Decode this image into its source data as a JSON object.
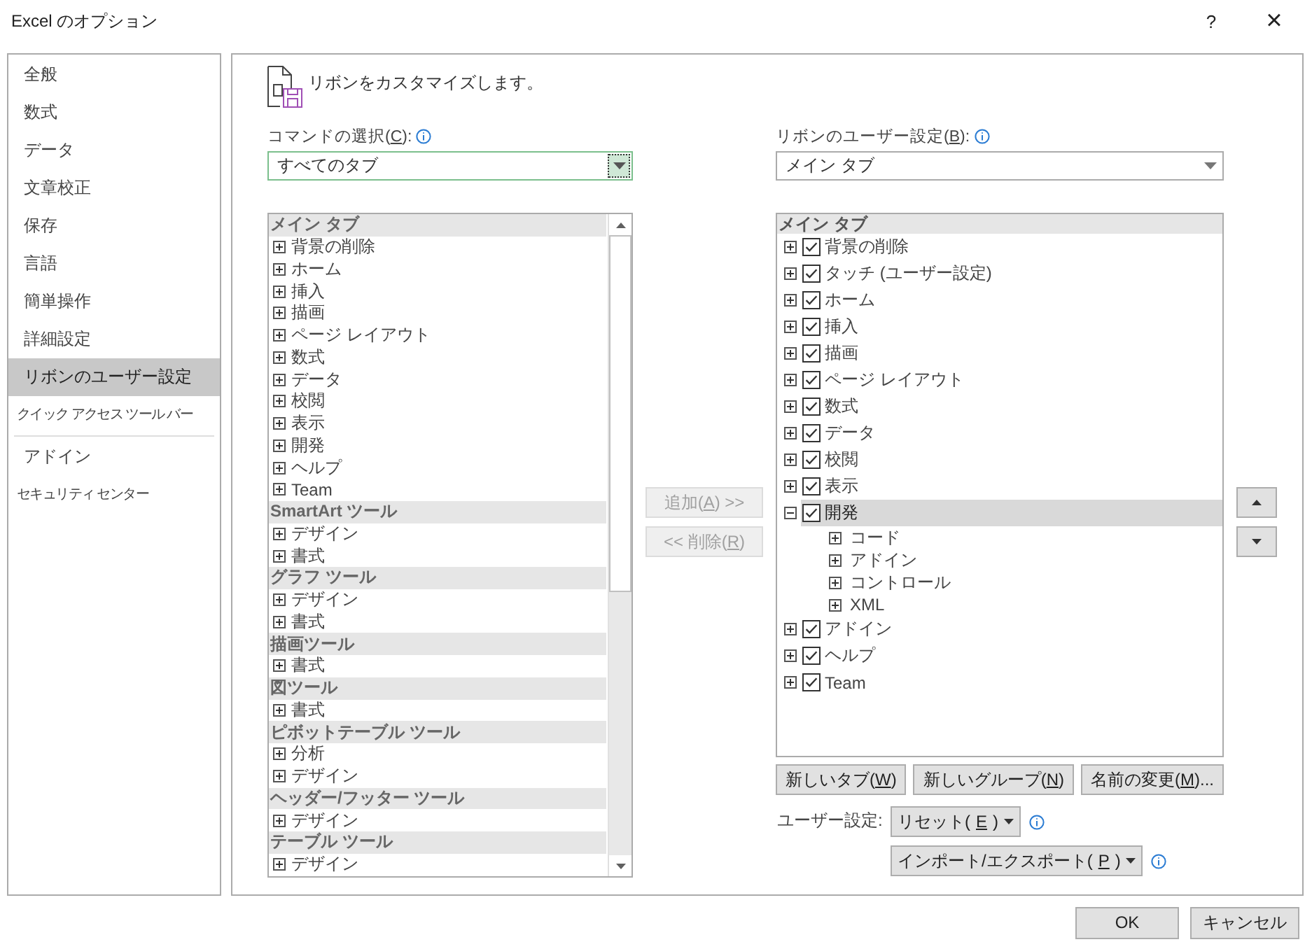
{
  "window": {
    "title": "Excel のオプション",
    "help": "?",
    "close": "×"
  },
  "sidebar": {
    "sections": [
      [
        {
          "label": "全般",
          "selected": false
        },
        {
          "label": "数式",
          "selected": false
        },
        {
          "label": "データ",
          "selected": false
        },
        {
          "label": "文章校正",
          "selected": false
        },
        {
          "label": "保存",
          "selected": false
        },
        {
          "label": "言語",
          "selected": false
        },
        {
          "label": "簡単操作",
          "selected": false
        },
        {
          "label": "詳細設定",
          "selected": false
        },
        {
          "label": "リボンのユーザー設定",
          "selected": true
        },
        {
          "label": "クイック アクセス ツール バー",
          "selected": false
        }
      ],
      [
        {
          "label": "アドイン",
          "selected": false
        },
        {
          "label": "セキュリティ センター",
          "selected": false
        }
      ]
    ]
  },
  "heading": "リボンをカスタマイズします。",
  "commands": {
    "label": {
      "pre": "コマンドの選択(",
      "key": "C",
      "post": "):"
    },
    "dropdown": {
      "value": "すべてのタブ",
      "focused": true
    },
    "rows": [
      {
        "kind": "header",
        "text": "メイン タブ"
      },
      {
        "kind": "item",
        "text": "背景の削除",
        "expanded": false
      },
      {
        "kind": "item",
        "text": "ホーム",
        "expanded": false
      },
      {
        "kind": "item",
        "text": "挿入",
        "expanded": false
      },
      {
        "kind": "item",
        "text": "描画",
        "expanded": false
      },
      {
        "kind": "item",
        "text": "ページ レイアウト",
        "expanded": false
      },
      {
        "kind": "item",
        "text": "数式",
        "expanded": false
      },
      {
        "kind": "item",
        "text": "データ",
        "expanded": false
      },
      {
        "kind": "item",
        "text": "校閲",
        "expanded": false
      },
      {
        "kind": "item",
        "text": "表示",
        "expanded": false
      },
      {
        "kind": "item",
        "text": "開発",
        "expanded": false
      },
      {
        "kind": "item",
        "text": "ヘルプ",
        "expanded": false
      },
      {
        "kind": "item",
        "text": "Team",
        "expanded": false
      },
      {
        "kind": "header",
        "text": "SmartArt ツール"
      },
      {
        "kind": "item",
        "text": "デザイン",
        "expanded": false
      },
      {
        "kind": "item",
        "text": "書式",
        "expanded": false
      },
      {
        "kind": "header",
        "text": "グラフ ツール"
      },
      {
        "kind": "item",
        "text": "デザイン",
        "expanded": false
      },
      {
        "kind": "item",
        "text": "書式",
        "expanded": false
      },
      {
        "kind": "header",
        "text": "描画ツール"
      },
      {
        "kind": "item",
        "text": "書式",
        "expanded": false
      },
      {
        "kind": "header",
        "text": "図ツール"
      },
      {
        "kind": "item",
        "text": "書式",
        "expanded": false
      },
      {
        "kind": "header",
        "text": "ピボットテーブル ツール"
      },
      {
        "kind": "item",
        "text": "分析",
        "expanded": false
      },
      {
        "kind": "item",
        "text": "デザイン",
        "expanded": false
      },
      {
        "kind": "header",
        "text": "ヘッダー/フッター ツール"
      },
      {
        "kind": "item",
        "text": "デザイン",
        "expanded": false
      },
      {
        "kind": "header",
        "text": "テーブル ツール"
      },
      {
        "kind": "item",
        "text": "デザイン",
        "expanded": false
      }
    ]
  },
  "transfer_buttons": [
    {
      "label": {
        "pre": "追加(",
        "key": "A",
        "post": ") >>"
      },
      "disabled": true
    },
    {
      "label": {
        "pre": "<< 削除(",
        "key": "R",
        "post": ")"
      },
      "disabled": true
    }
  ],
  "ribbon": {
    "label": {
      "pre": "リボンのユーザー設定(",
      "key": "B",
      "post": "):"
    },
    "dropdown": {
      "value": "メイン タブ",
      "focused": false
    },
    "tree": [
      {
        "kind": "header",
        "text": "メイン タブ"
      },
      {
        "kind": "tab",
        "text": "背景の削除",
        "checked": true,
        "expanded": false,
        "selected": false
      },
      {
        "kind": "tab",
        "text": "タッチ (ユーザー設定)",
        "checked": true,
        "expanded": false,
        "selected": false
      },
      {
        "kind": "tab",
        "text": "ホーム",
        "checked": true,
        "expanded": false,
        "selected": false
      },
      {
        "kind": "tab",
        "text": "挿入",
        "checked": true,
        "expanded": false,
        "selected": false
      },
      {
        "kind": "tab",
        "text": "描画",
        "checked": true,
        "expanded": false,
        "selected": false
      },
      {
        "kind": "tab",
        "text": "ページ レイアウト",
        "checked": true,
        "expanded": false,
        "selected": false
      },
      {
        "kind": "tab",
        "text": "数式",
        "checked": true,
        "expanded": false,
        "selected": false
      },
      {
        "kind": "tab",
        "text": "データ",
        "checked": true,
        "expanded": false,
        "selected": false
      },
      {
        "kind": "tab",
        "text": "校閲",
        "checked": true,
        "expanded": false,
        "selected": false
      },
      {
        "kind": "tab",
        "text": "表示",
        "checked": true,
        "expanded": false,
        "selected": false
      },
      {
        "kind": "tab",
        "text": "開発",
        "checked": true,
        "expanded": true,
        "selected": true,
        "children": [
          {
            "text": "コード",
            "expanded": false,
            "selected": false
          },
          {
            "text": "アドイン",
            "expanded": false,
            "selected": false
          },
          {
            "text": "コントロール",
            "expanded": false,
            "selected": false
          },
          {
            "text": "XML",
            "expanded": false,
            "selected": false
          }
        ]
      },
      {
        "kind": "tab",
        "text": "アドイン",
        "checked": true,
        "expanded": false,
        "selected": false
      },
      {
        "kind": "tab",
        "text": "ヘルプ",
        "checked": true,
        "expanded": false,
        "selected": false
      },
      {
        "kind": "tab",
        "text": "Team",
        "checked": true,
        "expanded": false,
        "selected": false
      }
    ]
  },
  "actions": [
    {
      "pre": "新しいタブ(",
      "key": "W",
      "post": ")"
    },
    {
      "pre": "新しいグループ(",
      "key": "N",
      "post": ")"
    },
    {
      "pre": "名前の変更(",
      "key": "M",
      "post": ")..."
    }
  ],
  "customizations": {
    "label": "ユーザー設定:",
    "buttons": [
      {
        "pre": "リセット(",
        "key": "E",
        "post": ")"
      },
      {
        "pre": "インポート/エクスポート(",
        "key": "P",
        "post": ")"
      }
    ]
  },
  "footer": {
    "buttons": [
      "OK",
      "キャンセル"
    ]
  }
}
